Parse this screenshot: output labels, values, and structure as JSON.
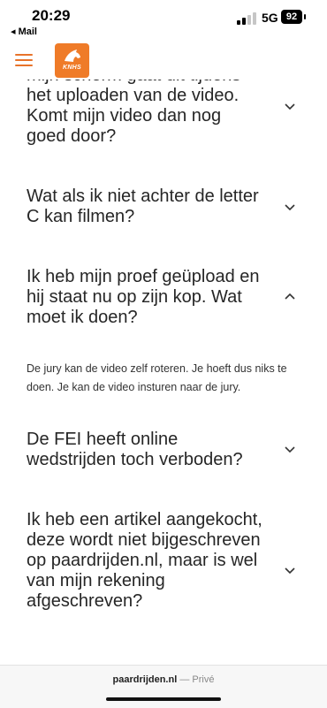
{
  "status_bar": {
    "time": "20:29",
    "back_label": "◂ Mail",
    "network": "5G",
    "battery": "92"
  },
  "header": {
    "logo_text": "KNHS",
    "brand_color": "#ef7b28"
  },
  "faq": [
    {
      "question": "mijn scherm gaat uit tijdens het uploaden van de video. Komt mijn video dan nog goed door?",
      "expanded": false
    },
    {
      "question": "Wat als ik niet achter de letter C kan filmen?",
      "expanded": false
    },
    {
      "question": "Ik heb mijn proef geüpload en hij staat nu op zijn kop. Wat moet ik doen?",
      "expanded": true,
      "answer": "De jury kan de video zelf roteren. Je hoeft dus niks te doen. Je kan de video insturen naar de jury."
    },
    {
      "question": "De FEI heeft online wedstrijden toch verboden?",
      "expanded": false
    },
    {
      "question": "Ik heb een artikel aangekocht, deze wordt niet bijgeschreven op paardrijden.nl, maar is wel van mijn rekening afgeschreven?",
      "expanded": false
    }
  ],
  "browser": {
    "domain": "paardrijden.nl",
    "separator": " — ",
    "mode": "Privé"
  }
}
